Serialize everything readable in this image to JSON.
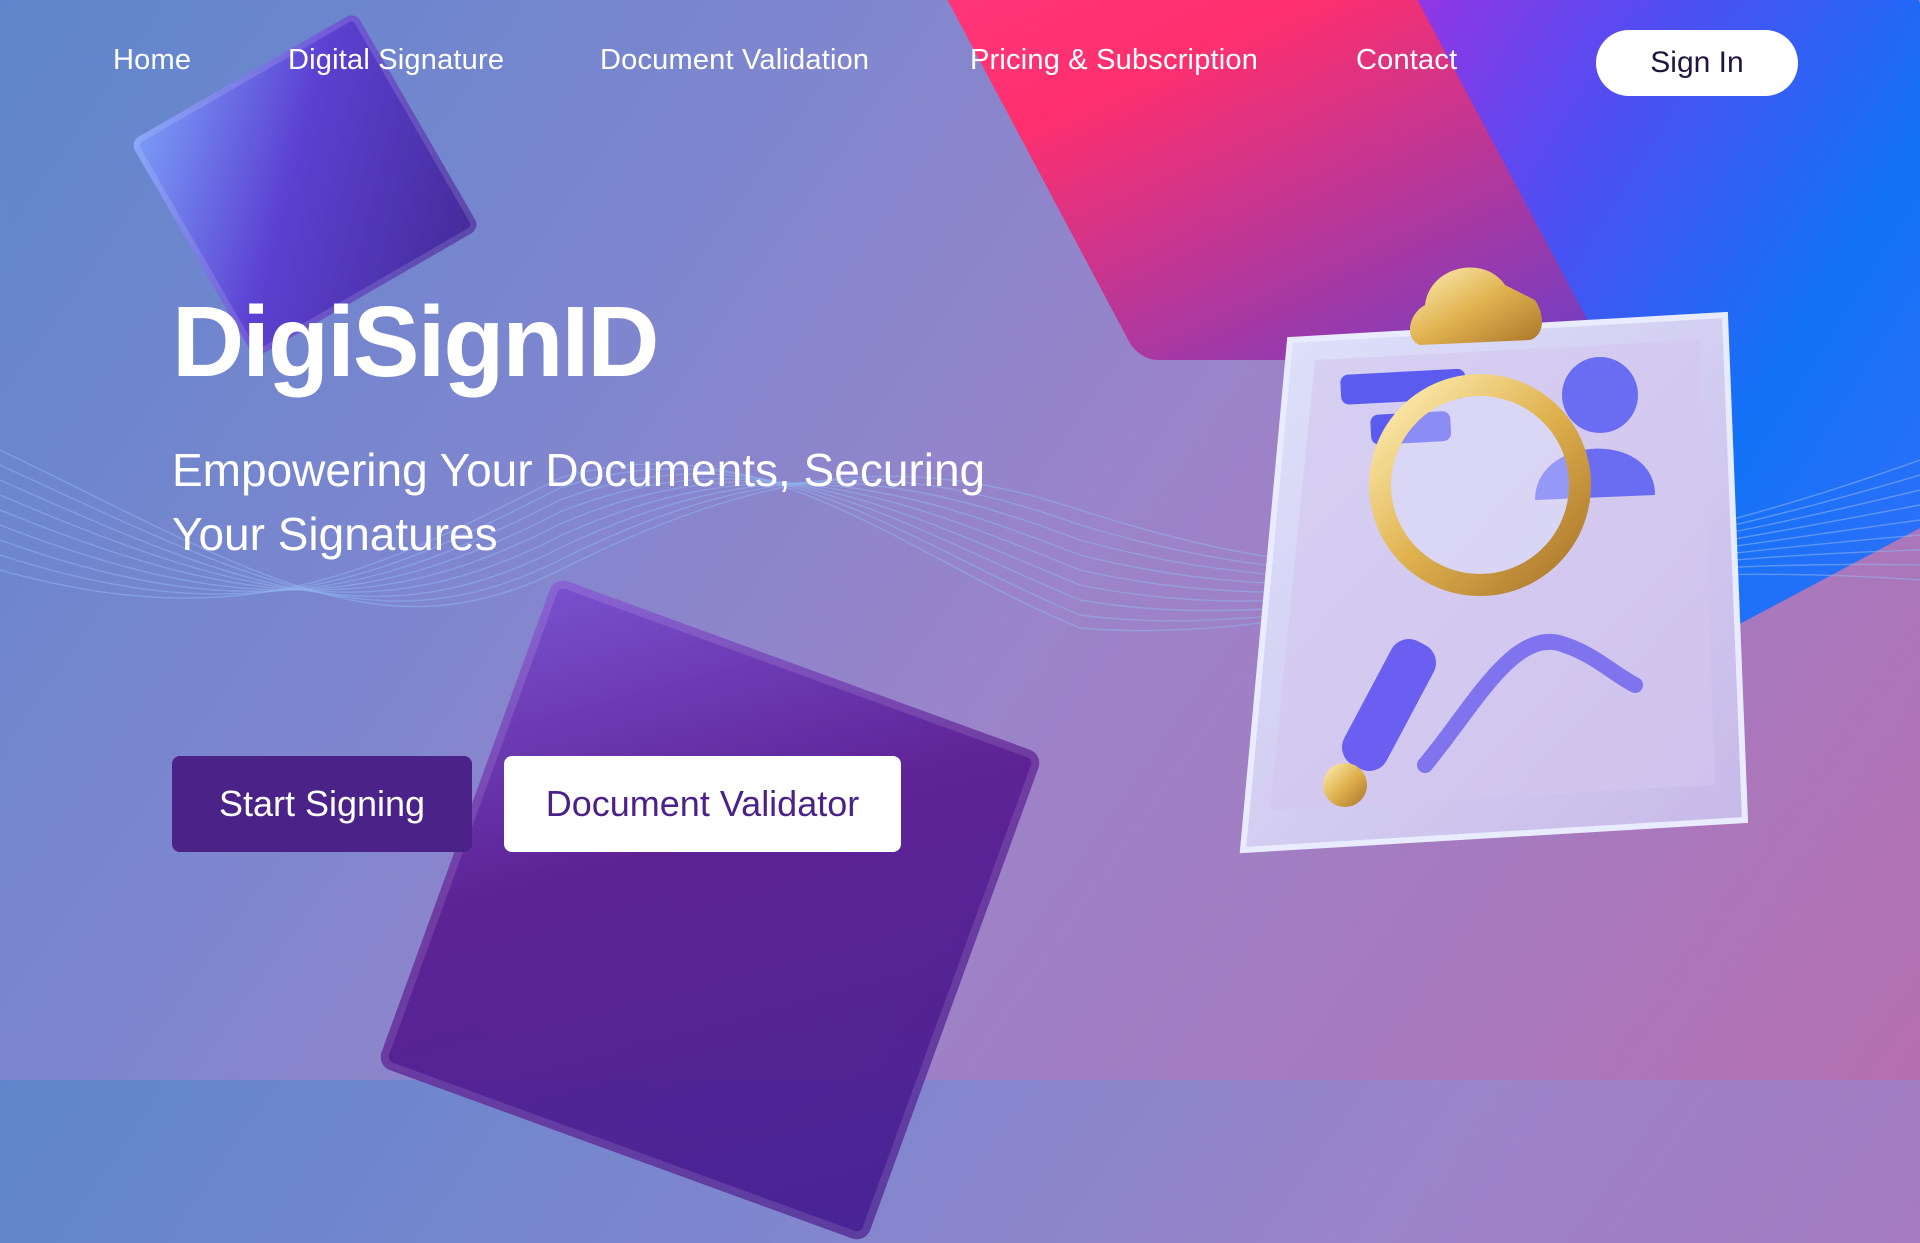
{
  "nav": {
    "items": [
      {
        "label": "Home"
      },
      {
        "label": "Digital Signature"
      },
      {
        "label": "Document Validation"
      },
      {
        "label": "Pricing & Subscription"
      },
      {
        "label": "Contact"
      }
    ],
    "sign_in_label": "Sign In"
  },
  "hero": {
    "brand": "DigiSignID",
    "tagline": "Empowering Your Documents, Securing Your Signatures",
    "primary_button": "Start Signing",
    "secondary_button": "Document Validator"
  },
  "colors": {
    "button_primary": "#4a2288",
    "button_secondary_text": "#4a2288",
    "text": "#ffffff"
  },
  "icons": [
    "clipboard-illustration",
    "magnifying-glass-icon"
  ]
}
